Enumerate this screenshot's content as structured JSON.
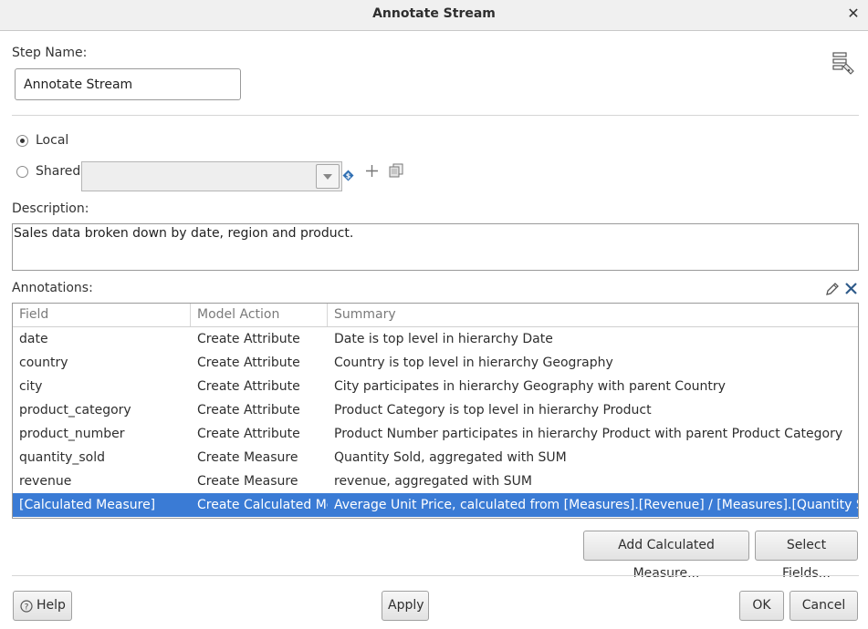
{
  "dialog": {
    "title": "Annotate Stream",
    "close_glyph": "✕"
  },
  "step": {
    "label": "Step Name:",
    "value": "Annotate Stream"
  },
  "scope": {
    "local_label": "Local",
    "shared_label": "Shared",
    "selected": "Local",
    "shared_value": ""
  },
  "description": {
    "label": "Description:",
    "value": "Sales data broken down by date, region and product."
  },
  "annotations": {
    "label": "Annotations:",
    "columns": [
      "Field",
      "Model Action",
      "Summary"
    ],
    "rows": [
      {
        "field": "date",
        "action": "Create Attribute",
        "summary": "Date is top level in hierarchy Date"
      },
      {
        "field": "country",
        "action": "Create Attribute",
        "summary": "Country is top level in hierarchy Geography"
      },
      {
        "field": "city",
        "action": "Create Attribute",
        "summary": "City participates in hierarchy Geography with parent Country"
      },
      {
        "field": "product_category",
        "action": "Create Attribute",
        "summary": "Product Category is top level in hierarchy Product"
      },
      {
        "field": "product_number",
        "action": "Create Attribute",
        "summary": "Product Number participates in hierarchy Product with parent Product Category"
      },
      {
        "field": "quantity_sold",
        "action": "Create Measure",
        "summary": "Quantity Sold, aggregated with SUM"
      },
      {
        "field": "revenue",
        "action": "Create Measure",
        "summary": "revenue, aggregated with SUM"
      },
      {
        "field": "[Calculated Measure]",
        "action": "Create Calculated Measure",
        "summary": "Average Unit Price, calculated from [Measures].[Revenue] / [Measures].[Quantity Sold]"
      }
    ],
    "selected_row": 7
  },
  "buttons": {
    "add_calculated": "Add Calculated Measure...",
    "select_fields": "Select Fields...",
    "help": "Help",
    "apply": "Apply",
    "ok": "OK",
    "cancel": "Cancel"
  },
  "colors": {
    "selection": "#3a7bd5",
    "accent_icon": "#2f6fb3"
  },
  "icons": [
    "close-icon",
    "step-documentation-icon",
    "radio-selected-icon",
    "radio-unselected-icon",
    "dropdown-arrow-icon",
    "variable-icon",
    "new-icon",
    "copy-icon",
    "edit-icon",
    "delete-icon",
    "help-icon"
  ]
}
